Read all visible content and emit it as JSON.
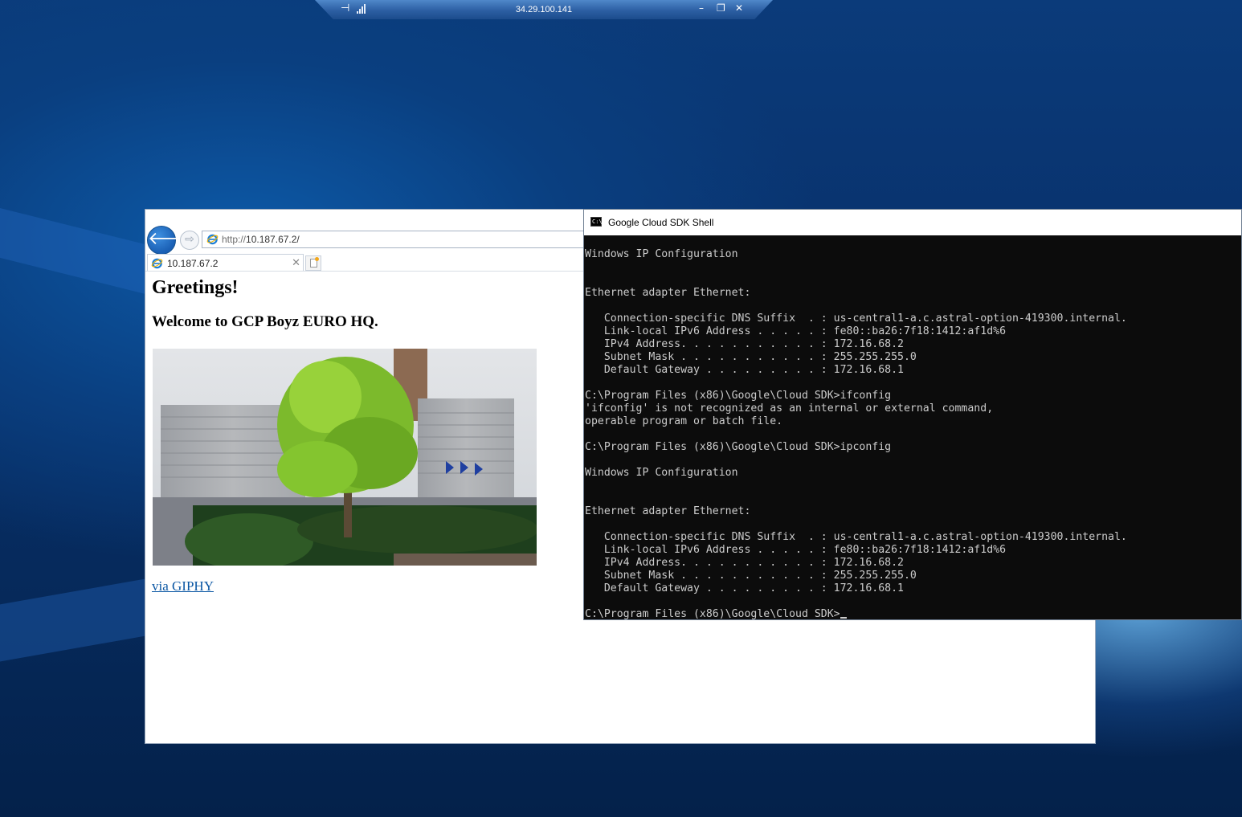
{
  "remote_bar": {
    "title": "34.29.100.141"
  },
  "browser": {
    "address_protocol": "http://",
    "address_host": "10.187.67.2/",
    "tab_label": "10.187.67.2",
    "page": {
      "heading": "Greetings!",
      "subheading": "Welcome to GCP Boyz EURO HQ.",
      "link_text": "via GIPHY"
    }
  },
  "shell": {
    "title": "Google Cloud SDK Shell",
    "lines": [
      "Windows IP Configuration",
      "",
      "",
      "Ethernet adapter Ethernet:",
      "",
      "   Connection-specific DNS Suffix  . : us-central1-a.c.astral-option-419300.internal.",
      "   Link-local IPv6 Address . . . . . : fe80::ba26:7f18:1412:af1d%6",
      "   IPv4 Address. . . . . . . . . . . : 172.16.68.2",
      "   Subnet Mask . . . . . . . . . . . : 255.255.255.0",
      "   Default Gateway . . . . . . . . . : 172.16.68.1",
      "",
      "C:\\Program Files (x86)\\Google\\Cloud SDK>ifconfig",
      "'ifconfig' is not recognized as an internal or external command,",
      "operable program or batch file.",
      "",
      "C:\\Program Files (x86)\\Google\\Cloud SDK>ipconfig",
      "",
      "Windows IP Configuration",
      "",
      "",
      "Ethernet adapter Ethernet:",
      "",
      "   Connection-specific DNS Suffix  . : us-central1-a.c.astral-option-419300.internal.",
      "   Link-local IPv6 Address . . . . . : fe80::ba26:7f18:1412:af1d%6",
      "   IPv4 Address. . . . . . . . . . . : 172.16.68.2",
      "   Subnet Mask . . . . . . . . . . . : 255.255.255.0",
      "   Default Gateway . . . . . . . . . : 172.16.68.1",
      ""
    ],
    "prompt": "C:\\Program Files (x86)\\Google\\Cloud SDK>"
  }
}
